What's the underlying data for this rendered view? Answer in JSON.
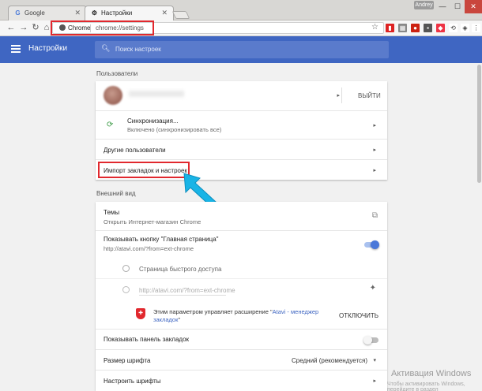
{
  "window": {
    "tabs": [
      {
        "label": "Google",
        "icon": "google-icon",
        "active": false
      },
      {
        "label": "Настройки",
        "icon": "gear-icon",
        "active": true
      }
    ],
    "user_badge": "Andrey",
    "controls": {
      "minimize": "—",
      "maximize": "☐",
      "close": "✕"
    }
  },
  "toolbar": {
    "omnibox_chip": "Chrome",
    "url": "chrome://settings",
    "highlight_color": "#e1282e"
  },
  "header": {
    "title": "Настройки",
    "search_placeholder": "Поиск настроек",
    "accent": "#3f66c2"
  },
  "users_section": {
    "title": "Пользователи",
    "signout_label": "ВЫЙТИ",
    "sync_title": "Синхронизация...",
    "sync_sub": "Включено (синхронизировать все)",
    "other_users": "Другие пользователи",
    "import": "Импорт закладок и настроек"
  },
  "appearance_section": {
    "title": "Внешний вид",
    "themes_title": "Темы",
    "themes_sub": "Открыть Интернет-магазин Chrome",
    "home_button_title": "Показывать кнопку \"Главная страница\"",
    "home_button_url": "http://atavi.com/?from=ext-chrome",
    "home_button_on": true,
    "radio_new_tab": "Страница быстрого доступа",
    "radio_url": "http://atavi.com/?from=ext-chrome",
    "ext_notice_prefix": "Этим параметром управляет расширение \"",
    "ext_notice_link": "Atavi - менеджер закладок",
    "ext_notice_suffix": "\"",
    "disable_button": "ОТКЛЮЧИТЬ",
    "bookmarks_bar": "Показывать панель закладок",
    "bookmarks_bar_on": false,
    "font_size_label": "Размер шрифта",
    "font_size_value": "Средний (рекомендуется)",
    "fonts_label": "Настроить шрифты"
  },
  "watermark": {
    "line1": "Активация Windows",
    "line2": "Чтобы активировать Windows, перейдите в раздел"
  },
  "colors": {
    "toggle_on": "#4a78d9",
    "arrow": "#19b4e6",
    "link": "#3f66c2"
  }
}
